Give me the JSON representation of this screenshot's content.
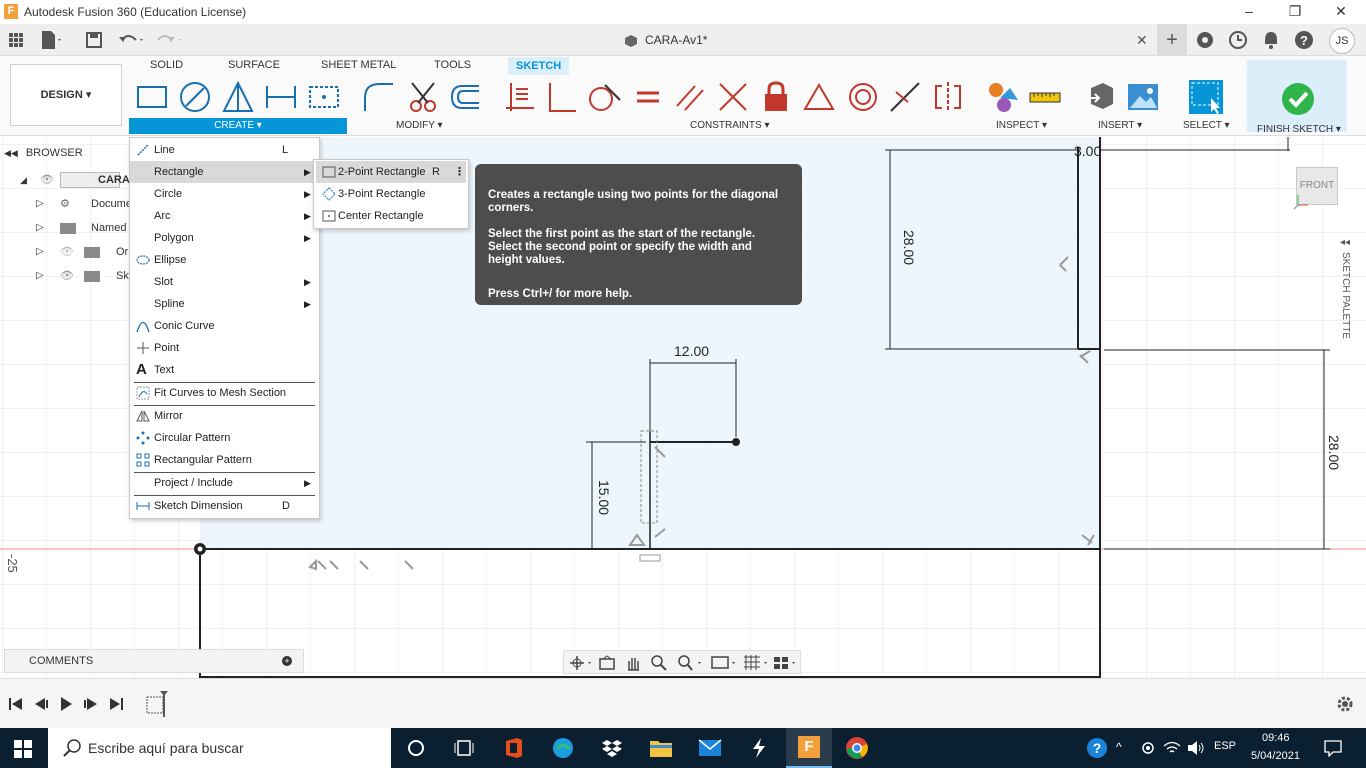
{
  "window": {
    "app_icon": "F",
    "title": "Autodesk Fusion 360 (Education License)",
    "minimize": "–",
    "restore": "❐",
    "close": "✕"
  },
  "doc_tab": {
    "name": "CARA-Av1*",
    "close": "✕",
    "user_initials": "JS"
  },
  "ribbon": {
    "workspace": "DESIGN ▾",
    "tabs": [
      "SOLID",
      "SURFACE",
      "SHEET METAL",
      "TOOLS",
      "SKETCH"
    ],
    "groups": {
      "create": "CREATE ▾",
      "modify": "MODIFY ▾",
      "constraints": "CONSTRAINTS ▾",
      "inspect": "INSPECT ▾",
      "insert": "INSERT ▾",
      "select": "SELECT ▾",
      "finish": "FINISH SKETCH ▾"
    }
  },
  "browser": {
    "header": "BROWSER",
    "root": "CARA",
    "items": [
      "Docume",
      "Named ",
      "Or",
      "Sk"
    ]
  },
  "create_menu": {
    "items": [
      {
        "label": "Line",
        "key": "L"
      },
      {
        "label": "Rectangle",
        "submenu": true
      },
      {
        "label": "Circle",
        "submenu": true
      },
      {
        "label": "Arc",
        "submenu": true
      },
      {
        "label": "Polygon",
        "submenu": true
      },
      {
        "label": "Ellipse"
      },
      {
        "label": "Slot",
        "submenu": true
      },
      {
        "label": "Spline",
        "submenu": true
      },
      {
        "label": "Conic Curve"
      },
      {
        "label": "Point"
      },
      {
        "label": "Text"
      },
      {
        "label": "Fit Curves to Mesh Section"
      },
      {
        "label": "Mirror"
      },
      {
        "label": "Circular Pattern"
      },
      {
        "label": "Rectangular Pattern"
      },
      {
        "label": "Project / Include",
        "submenu": true
      },
      {
        "label": "Sketch Dimension",
        "key": "D"
      }
    ]
  },
  "rectangle_submenu": {
    "items": [
      {
        "label": "2-Point Rectangle",
        "key": "R"
      },
      {
        "label": "3-Point Rectangle"
      },
      {
        "label": "Center Rectangle"
      }
    ]
  },
  "tooltip": {
    "line1": "Creates a rectangle using two points for the diagonal corners.",
    "line2": "Select the first point as the start of the rectangle. Select the second point or specify the width and height values.",
    "line3": "Press Ctrl+/ for more help."
  },
  "sketch": {
    "dim_width": "12.00",
    "dim_height": "15.00",
    "dim_top_right_vertical": "28.00",
    "dim_right_vertical": "28.00",
    "dim_top": "3.00",
    "axis_label": "-25",
    "viewcube": "FRONT",
    "palette": "SKETCH PALETTE"
  },
  "comments": {
    "label": "COMMENTS"
  },
  "taskbar": {
    "search_placeholder": "Escribe aquí para buscar",
    "language": "ESP",
    "time": "09:46",
    "date": "5/04/2021"
  },
  "colors": {
    "accent": "#0696d7",
    "canvas_fill": "#eef6fc",
    "taskbar": "#0a1f2f",
    "finish_green": "#2fb54a"
  }
}
